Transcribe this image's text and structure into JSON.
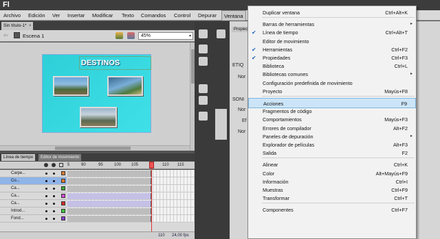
{
  "app": {
    "logo": "Fl"
  },
  "menubar": {
    "items": [
      "Archivo",
      "Edición",
      "Ver",
      "Insertar",
      "Modificar",
      "Texto",
      "Comandos",
      "Control",
      "Depurar",
      "Ventana"
    ]
  },
  "document": {
    "tab_title": "Sin título-1*",
    "tab_close": "×",
    "scene_label": "Escena 1",
    "zoom_value": "45%"
  },
  "stage": {
    "banner_text": "DESTINOS"
  },
  "timeline": {
    "tabs": [
      "Línea de tiempo",
      "Editor de movimiento"
    ],
    "frame_numbers": [
      "5",
      "90",
      "95",
      "100",
      "105",
      "110",
      "115"
    ],
    "playhead_frame": "11",
    "layers": [
      {
        "name": "Carpe...",
        "selected": false,
        "color": "#e07a2a"
      },
      {
        "name": "Co...",
        "selected": true,
        "color": "#e07a2a"
      },
      {
        "name": "Ca...",
        "selected": false,
        "color": "#38a838"
      },
      {
        "name": "Ca...",
        "selected": false,
        "color": "#d84ad8"
      },
      {
        "name": "Ca...",
        "selected": false,
        "color": "#d82a2a"
      },
      {
        "name": "Introd...",
        "selected": false,
        "color": "#38c838"
      },
      {
        "name": "Fond...",
        "selected": false,
        "color": "#8a3ad8"
      }
    ],
    "footer": {
      "frame": "110",
      "fps": "24,00 fps"
    }
  },
  "properties": {
    "tab": "Propiec",
    "sections": [
      "ETIQ",
      "SONI"
    ],
    "labels": [
      "Nor",
      "Nor",
      "Ef",
      "Nor"
    ]
  },
  "window_menu": {
    "items": [
      {
        "label": "Duplicar ventana",
        "shortcut": "Ctrl+Alt+K",
        "checked": false,
        "submenu": false
      },
      {
        "separator": true
      },
      {
        "label": "Barras de herramientas",
        "shortcut": "",
        "checked": false,
        "submenu": true
      },
      {
        "label": "Línea de tiempo",
        "shortcut": "Ctrl+Alt+T",
        "checked": true,
        "submenu": false
      },
      {
        "label": "Editor de movimiento",
        "shortcut": "",
        "checked": false,
        "submenu": false
      },
      {
        "label": "Herramientas",
        "shortcut": "Ctrl+F2",
        "checked": true,
        "submenu": false
      },
      {
        "label": "Propiedades",
        "shortcut": "Ctrl+F3",
        "checked": true,
        "submenu": false
      },
      {
        "label": "Biblioteca",
        "shortcut": "Ctrl+L",
        "checked": false,
        "submenu": false
      },
      {
        "label": "Bibliotecas comunes",
        "shortcut": "",
        "checked": false,
        "submenu": true
      },
      {
        "label": "Configuración predefinida de movimiento",
        "shortcut": "",
        "checked": false,
        "submenu": false
      },
      {
        "label": "Proyecto",
        "shortcut": "Mayús+F8",
        "checked": false,
        "submenu": false
      },
      {
        "separator": true
      },
      {
        "label": "Acciones",
        "shortcut": "F9",
        "checked": false,
        "submenu": false,
        "highlighted": true
      },
      {
        "label": "Fragmentos de código",
        "shortcut": "",
        "checked": false,
        "submenu": false
      },
      {
        "label": "Comportamientos",
        "shortcut": "Mayús+F3",
        "checked": false,
        "submenu": false
      },
      {
        "label": "Errores de compilador",
        "shortcut": "Alt+F2",
        "checked": false,
        "submenu": false
      },
      {
        "label": "Paneles de depuración",
        "shortcut": "",
        "checked": false,
        "submenu": true
      },
      {
        "label": "Explorador de películas",
        "shortcut": "Alt+F3",
        "checked": false,
        "submenu": false
      },
      {
        "label": "Salida",
        "shortcut": "F2",
        "checked": false,
        "submenu": false
      },
      {
        "separator": true
      },
      {
        "label": "Alinear",
        "shortcut": "Ctrl+K",
        "checked": false,
        "submenu": false
      },
      {
        "label": "Color",
        "shortcut": "Alt+Mayús+F9",
        "checked": false,
        "submenu": false
      },
      {
        "label": "Información",
        "shortcut": "Ctrl+I",
        "checked": false,
        "submenu": false
      },
      {
        "label": "Muestras",
        "shortcut": "Ctrl+F9",
        "checked": false,
        "submenu": false
      },
      {
        "label": "Transformar",
        "shortcut": "Ctrl+T",
        "checked": false,
        "submenu": false
      },
      {
        "separator": true
      },
      {
        "label": "Componentes",
        "shortcut": "Ctrl+F7",
        "checked": false,
        "submenu": false
      }
    ]
  },
  "glyphs": {
    "check": "✔",
    "submenu": "▸",
    "dropdown_arrow": "▾",
    "back": "⇦"
  }
}
